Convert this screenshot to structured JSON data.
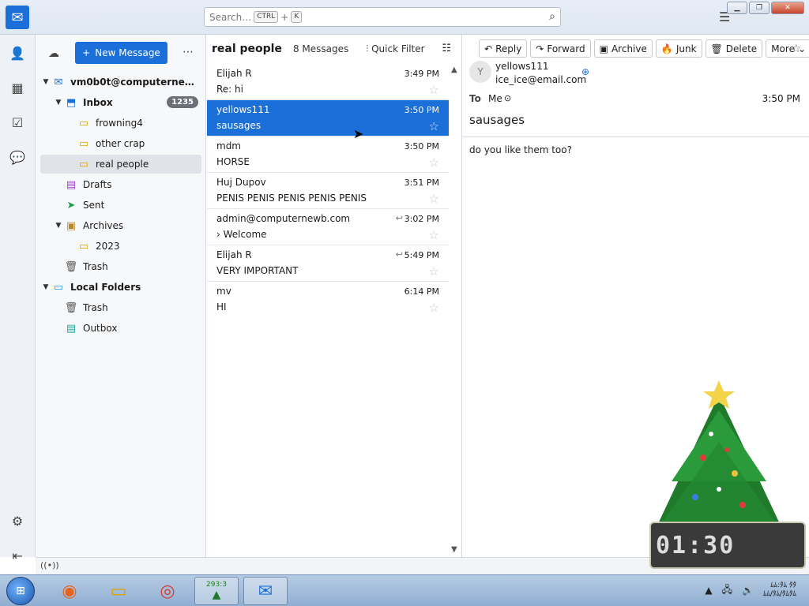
{
  "search": {
    "placeholder": "Search…",
    "key1": "CTRL",
    "plus": "+",
    "key2": "K"
  },
  "new_message_label": "New Message",
  "folders": [
    {
      "label": "vm0b0t@computerne…",
      "bold": true
    },
    {
      "label": "Inbox",
      "bold": true,
      "badge": "1235"
    },
    {
      "label": "frowning4"
    },
    {
      "label": "other crap"
    },
    {
      "label": "real people"
    },
    {
      "label": "Drafts"
    },
    {
      "label": "Sent"
    },
    {
      "label": "Archives"
    },
    {
      "label": "2023"
    },
    {
      "label": "Trash"
    },
    {
      "label": "Local Folders",
      "bold": true
    },
    {
      "label": "Trash"
    },
    {
      "label": "Outbox"
    }
  ],
  "message_list": {
    "title": "real people",
    "count": "8 Messages",
    "quick_filter": "Quick Filter",
    "rows": [
      {
        "from": "Elijah R",
        "subject": "Re: hi",
        "time": "3:49 PM"
      },
      {
        "from": "yellows111",
        "subject": "sausages",
        "time": "3:50 PM"
      },
      {
        "from": "mdm",
        "subject": "HORSE",
        "time": "3:50 PM"
      },
      {
        "from": "Huj Dupov",
        "subject": "PENIS PENIS PENIS PENIS PENIS",
        "time": "3:51 PM"
      },
      {
        "from": "admin@computernewb.com",
        "subject": "Welcome",
        "time": "3:02 PM"
      },
      {
        "from": "Elijah R",
        "subject": "VERY IMPORTANT",
        "time": "5:49 PM"
      },
      {
        "from": "mv",
        "subject": "HI",
        "time": "6:14 PM"
      }
    ]
  },
  "reader": {
    "toolbar": {
      "reply": "Reply",
      "forward": "Forward",
      "archive": "Archive",
      "junk": "Junk",
      "delete": "Delete",
      "more": "More"
    },
    "avatar_letter": "Y",
    "sender_name": "yellows111",
    "sender_email": "ice_ice@email.com",
    "to_label": "To",
    "to_value": "Me",
    "time": "3:50 PM",
    "subject": "sausages",
    "body": "do you like them too?"
  },
  "taskbar": {
    "tree_counter": "293:3",
    "clock_line1": "ﾑﾑ:ﾀﾑ ﾀﾀ",
    "clock_line2": "ﾑﾑ/ﾀﾑ/ﾀﾑﾀﾑ"
  },
  "desktop_clock": "01:30",
  "colors": {
    "accent": "#1b6fd8",
    "selected_row": "#1b6fd8"
  }
}
